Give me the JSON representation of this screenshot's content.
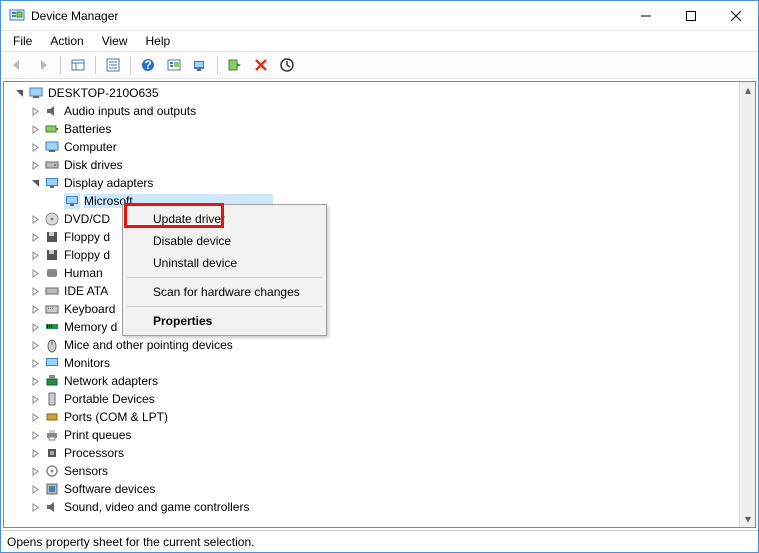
{
  "window": {
    "title": "Device Manager"
  },
  "menubar": [
    "File",
    "Action",
    "View",
    "Help"
  ],
  "root_node": "DESKTOP-210O635",
  "categories": [
    "Audio inputs and outputs",
    "Batteries",
    "Computer",
    "Disk drives",
    "Display adapters",
    "DVD/CD",
    "Floppy d",
    "Floppy d",
    "Human",
    "IDE ATA",
    "Keyboard",
    "Memory d",
    "Mice and other pointing devices",
    "Monitors",
    "Network adapters",
    "Portable Devices",
    "Ports (COM & LPT)",
    "Print queues",
    "Processors",
    "Sensors",
    "Software devices",
    "Sound, video and game controllers"
  ],
  "selected_device_partial": "Microsoft",
  "context_menu": {
    "update": "Update driver",
    "disable": "Disable device",
    "uninstall": "Uninstall device",
    "scan": "Scan for hardware changes",
    "properties": "Properties"
  },
  "statusbar": "Opens property sheet for the current selection."
}
